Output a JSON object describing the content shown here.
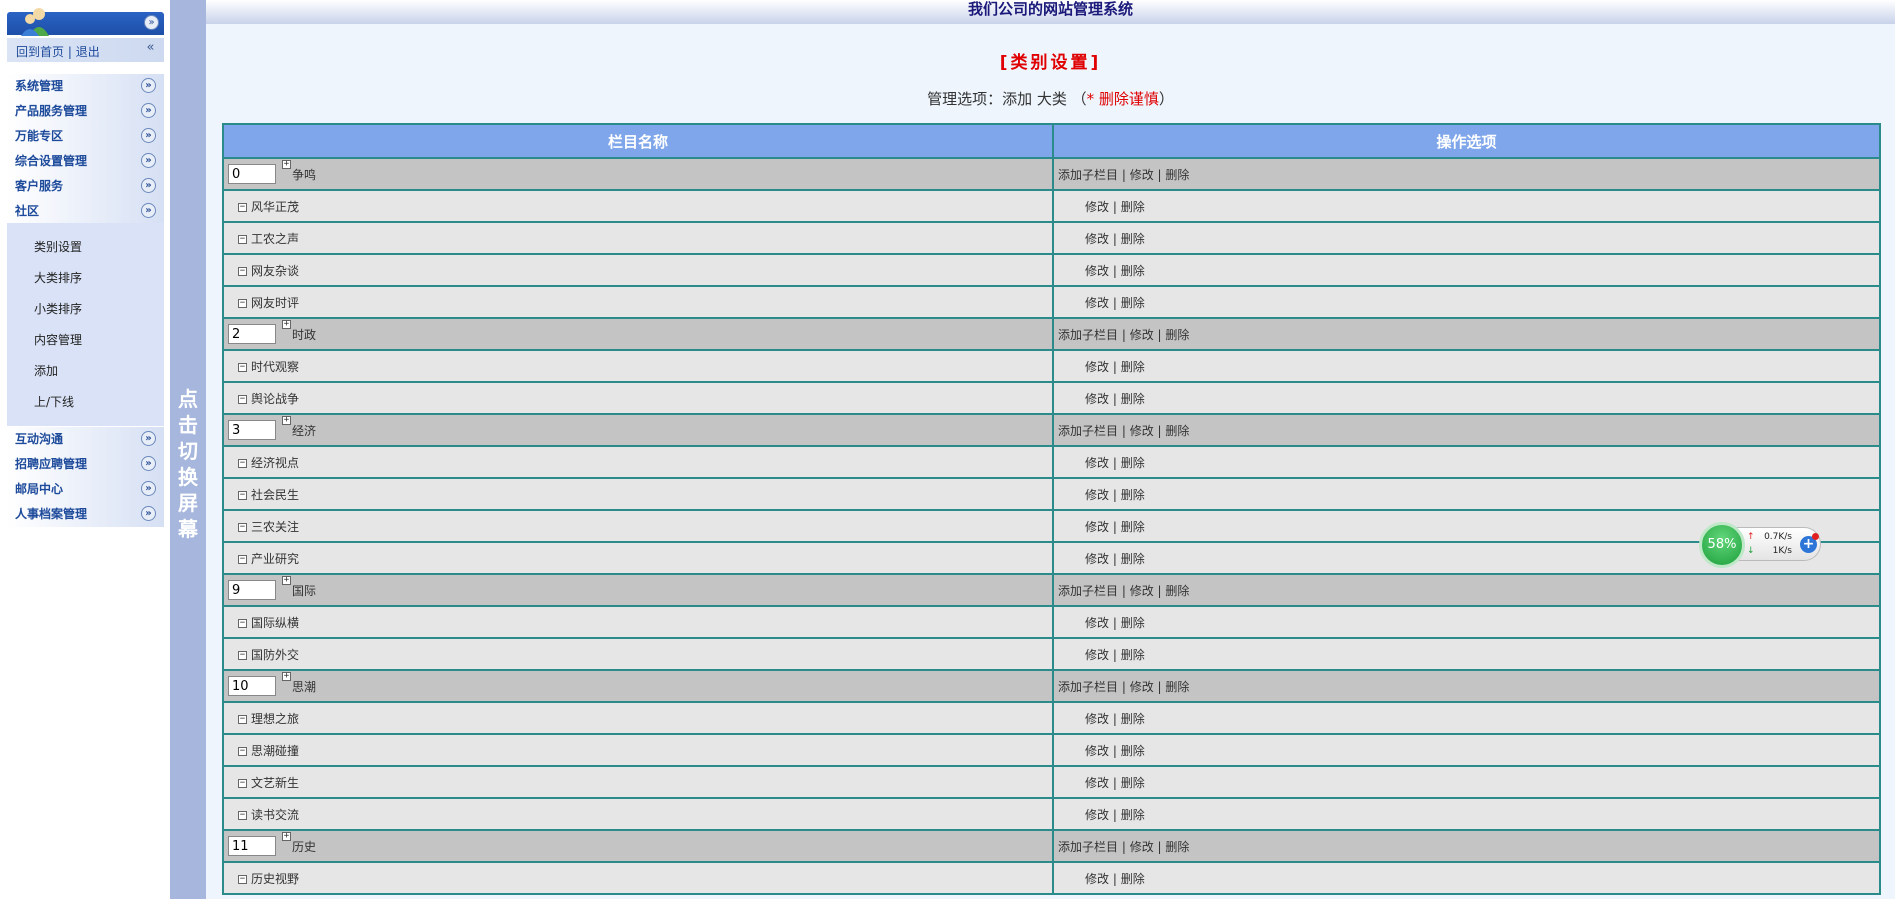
{
  "app": {
    "system_title": "我们公司的网站管理系统"
  },
  "sidebar": {
    "home_link": "回到首页",
    "separator": "|",
    "logout_link": "退出",
    "menu_top": [
      {
        "label": "系统管理"
      },
      {
        "label": "产品服务管理"
      },
      {
        "label": "万能专区"
      },
      {
        "label": "综合设置管理"
      },
      {
        "label": "客户服务"
      },
      {
        "label": "社区"
      }
    ],
    "submenu": [
      {
        "label": "类别设置"
      },
      {
        "label": "大类排序"
      },
      {
        "label": "小类排序"
      },
      {
        "label": "内容管理"
      },
      {
        "label": "添加"
      },
      {
        "label": "上/下线"
      }
    ],
    "menu_bottom": [
      {
        "label": "互动沟通"
      },
      {
        "label": "招聘应聘管理"
      },
      {
        "label": "邮局中心"
      },
      {
        "label": "人事档案管理"
      }
    ]
  },
  "switch_bar": {
    "label": "点击切换屏幕"
  },
  "page": {
    "heading": "[类别设置]",
    "manage_prefix": "管理选项：添加 大类 （",
    "manage_warning": "* 删除谨慎",
    "manage_suffix": "）"
  },
  "table": {
    "headers": {
      "name": "栏目名称",
      "ops": "操作选项"
    },
    "op_labels": {
      "add_child": "添加子栏目",
      "edit": "修改",
      "delete": "删除",
      "sep": " | "
    },
    "groups": [
      {
        "order": "0",
        "name": "争鸣",
        "children": [
          "风华正茂",
          "工农之声",
          "网友杂谈",
          "网友时评"
        ]
      },
      {
        "order": "2",
        "name": "时政",
        "children": [
          "时代观察",
          "舆论战争"
        ]
      },
      {
        "order": "3",
        "name": "经济",
        "children": [
          "经济视点",
          "社会民生",
          "三农关注",
          "产业研究"
        ]
      },
      {
        "order": "9",
        "name": "国际",
        "children": [
          "国际纵横",
          "国防外交"
        ]
      },
      {
        "order": "10",
        "name": "思潮",
        "children": [
          "理想之旅",
          "思潮碰撞",
          "文艺新生",
          "读书交流"
        ]
      },
      {
        "order": "11",
        "name": "历史",
        "children": [
          "历史视野"
        ]
      }
    ]
  },
  "net_widget": {
    "percent": "58%",
    "up_speed": "0.7K/s",
    "down_speed": "1K/s"
  }
}
